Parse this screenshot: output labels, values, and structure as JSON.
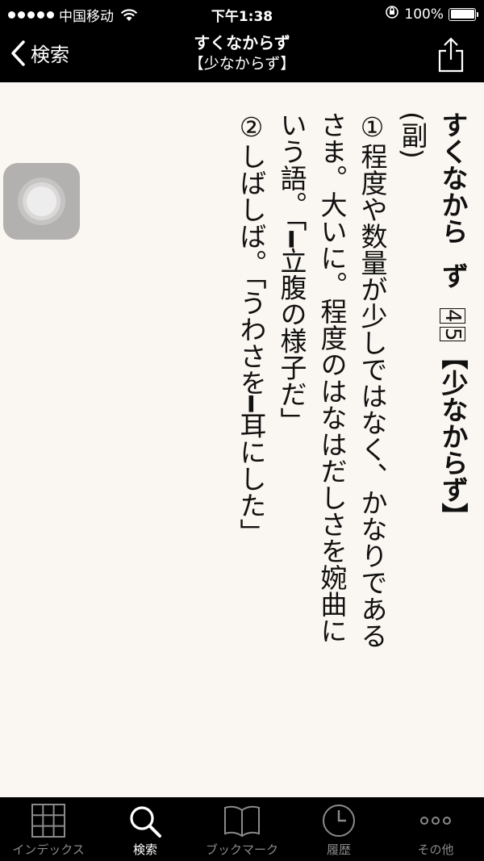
{
  "status_bar": {
    "carrier": "中国移动",
    "time": "下午1:38",
    "battery": "100%",
    "battery_level": 1.0
  },
  "nav": {
    "back_label": "検索",
    "title": "すくなからず",
    "subtitle": "【少なからず】"
  },
  "entry": {
    "headword_a": "すくなから",
    "headword_b": "ず",
    "accent_1": "4",
    "accent_2": "5",
    "kanji_form": "【少なからず】",
    "pos": "(副)",
    "def1": "①程度や数量が少しではなく、かなりであるさま。大いに。程度のはなはだしさを婉曲にいう語。「━立腹の様子だ」",
    "def2": "②しばしば。「うわさを━耳にした」"
  },
  "tabs": [
    {
      "id": "index",
      "label": "インデックス",
      "icon": "grid-icon"
    },
    {
      "id": "search",
      "label": "検索",
      "icon": "search-icon"
    },
    {
      "id": "bookmark",
      "label": "ブックマーク",
      "icon": "book-icon"
    },
    {
      "id": "history",
      "label": "履歴",
      "icon": "clock-icon"
    },
    {
      "id": "more",
      "label": "その他",
      "icon": "more-icon"
    }
  ],
  "colors": {
    "bar": "#000000",
    "page": "#faf6f1",
    "tab_active": "#ffffff",
    "tab_inactive": "#8a8a8a"
  }
}
